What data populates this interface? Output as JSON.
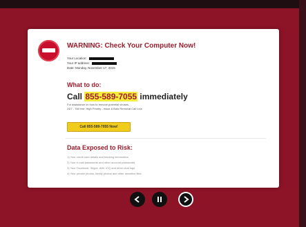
{
  "warning": {
    "title": "WARNING: Check Your Computer Now!",
    "location_label": "Your Location:",
    "ip_label": "Your IP address:",
    "date_label": "Date: Monday, November 17, 2015"
  },
  "action": {
    "heading": "What to do:",
    "call_prefix": "Call ",
    "phone": "855-589-7055",
    "call_suffix": " immediately",
    "note_line1": "For assistance on how to remove potential viruses.",
    "note_line2": "24/7 - Toll free: High Priority - Issue & Bots Removal Call Line",
    "call_button": "Call 855-589-7055 Now!"
  },
  "risk": {
    "heading": "Data Exposed to Risk:",
    "items": [
      "1) Your credit card details and banking information",
      "2) Your e-mail passwords and other account passwords",
      "3) Your Facebook, Skype, AIM, ICQ and other chat logs",
      "4) Your private photos, family photos and other sensitive files"
    ]
  },
  "controls": {
    "prev_icon": "arrow-left-icon",
    "pause_icon": "pause-icon",
    "next_icon": "arrow-right-icon"
  },
  "colors": {
    "background": "#8d1426",
    "accent_red": "#9b1b2a",
    "highlight_yellow": "#f6ec3b",
    "button_yellow": "#f2cc1d"
  }
}
